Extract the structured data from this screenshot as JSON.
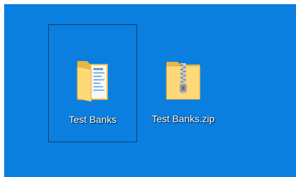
{
  "desktop": {
    "background": "#0a7fe0",
    "icons": [
      {
        "label": "Test Banks",
        "icon": "folder-icon",
        "selected": true
      },
      {
        "label": "Test Banks.zip",
        "icon": "zip-folder-icon",
        "selected": false
      }
    ]
  },
  "colors": {
    "folder_light": "#ffe9a4",
    "folder_dark": "#f2c14e",
    "selection_border": "#1d3a63"
  }
}
